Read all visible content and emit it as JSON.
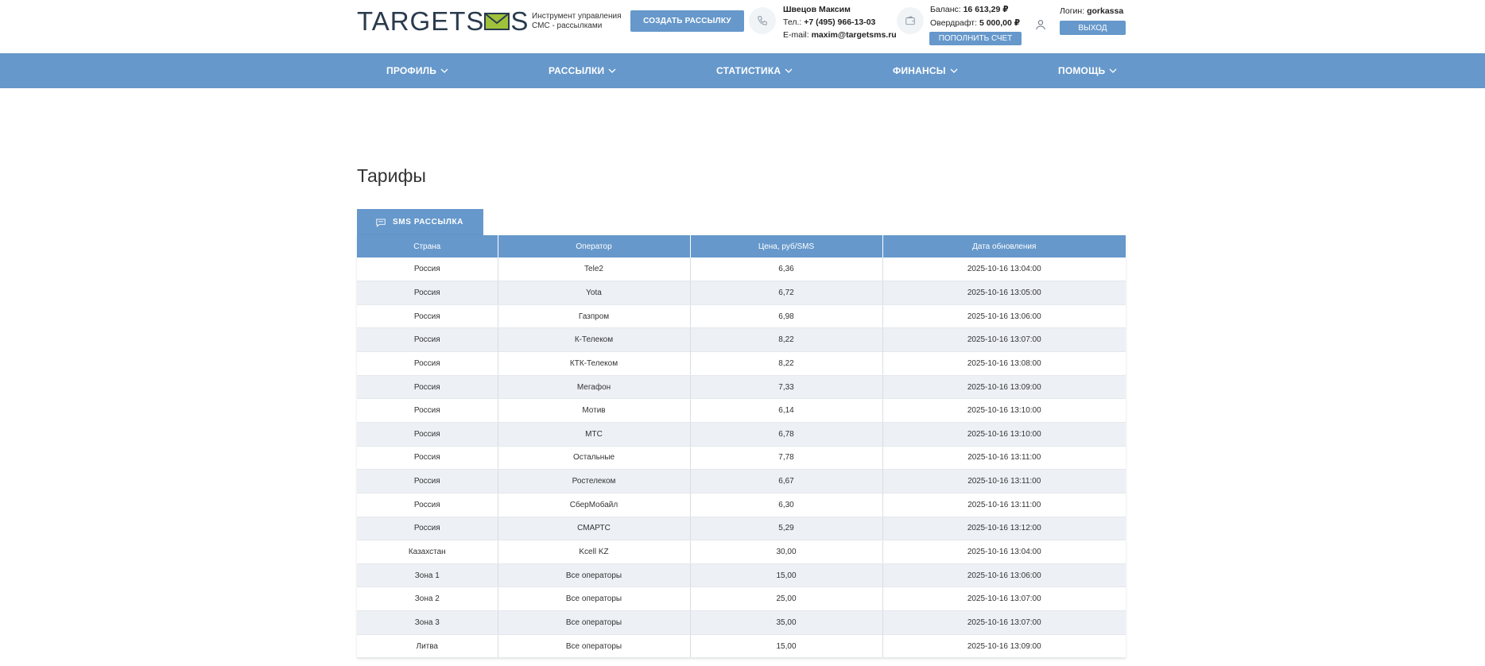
{
  "header": {
    "logo": {
      "part1": "TARGET",
      "part2": "S",
      "part3": "S"
    },
    "tagline": [
      "Инструмент управления",
      "СМС - рассылками"
    ],
    "create_button": "СОЗДАТЬ РАССЫЛКУ",
    "contact": {
      "name": "Швецов Максим",
      "phone_label": "Тел.:",
      "phone": "+7 (495) 966-13-03",
      "email_label": "E-mail:",
      "email": "maxim@targetsms.ru"
    },
    "balance": {
      "balance_label": "Баланс:",
      "balance_value": "16 613,29 ₽",
      "overdraft_label": "Овердрафт:",
      "overdraft_value": "5 000,00 ₽",
      "topup_button": "ПОПОЛНИТЬ СЧЕТ"
    },
    "login": {
      "label": "Логин:",
      "value": "gorkassa",
      "logout_button": "ВЫХОД"
    }
  },
  "nav": {
    "items": [
      "ПРОФИЛЬ",
      "РАССЫЛКИ",
      "СТАТИСТИКА",
      "ФИНАНСЫ",
      "ПОМОЩЬ"
    ]
  },
  "main": {
    "title": "Тарифы",
    "tab_label": "SMS РАССЫЛКА",
    "table": {
      "columns": [
        "Страна",
        "Оператор",
        "Цена, руб/SMS",
        "Дата обновления"
      ],
      "rows": [
        [
          "Россия",
          "Tele2",
          "6,36",
          "2025-10-16 13:04:00"
        ],
        [
          "Россия",
          "Yota",
          "6,72",
          "2025-10-16 13:05:00"
        ],
        [
          "Россия",
          "Газпром",
          "6,98",
          "2025-10-16 13:06:00"
        ],
        [
          "Россия",
          "К-Телеком",
          "8,22",
          "2025-10-16 13:07:00"
        ],
        [
          "Россия",
          "КТК-Телеком",
          "8,22",
          "2025-10-16 13:08:00"
        ],
        [
          "Россия",
          "Мегафон",
          "7,33",
          "2025-10-16 13:09:00"
        ],
        [
          "Россия",
          "Мотив",
          "6,14",
          "2025-10-16 13:10:00"
        ],
        [
          "Россия",
          "МТС",
          "6,78",
          "2025-10-16 13:10:00"
        ],
        [
          "Россия",
          "Остальные",
          "7,78",
          "2025-10-16 13:11:00"
        ],
        [
          "Россия",
          "Ростелеком",
          "6,67",
          "2025-10-16 13:11:00"
        ],
        [
          "Россия",
          "СберМобайл",
          "6,30",
          "2025-10-16 13:11:00"
        ],
        [
          "Россия",
          "СМАРТС",
          "5,29",
          "2025-10-16 13:12:00"
        ],
        [
          "Казахстан",
          "Kcell KZ",
          "30,00",
          "2025-10-16 13:04:00"
        ],
        [
          "Зона 1",
          "Все операторы",
          "15,00",
          "2025-10-16 13:06:00"
        ],
        [
          "Зона 2",
          "Все операторы",
          "25,00",
          "2025-10-16 13:07:00"
        ],
        [
          "Зона 3",
          "Все операторы",
          "35,00",
          "2025-10-16 13:07:00"
        ],
        [
          "Литва",
          "Все операторы",
          "15,00",
          "2025-10-16 13:09:00"
        ]
      ]
    }
  },
  "icons": [
    "phone-icon",
    "wallet-icon",
    "user-icon",
    "chevron-down-icon",
    "sms-icon",
    "envelope-logo-icon"
  ],
  "colors": {
    "accent": "#6698cb",
    "logo_text": "#2a3b4d",
    "logo_envelope": "#9fc23a",
    "row_alt": "#edf0f5"
  }
}
